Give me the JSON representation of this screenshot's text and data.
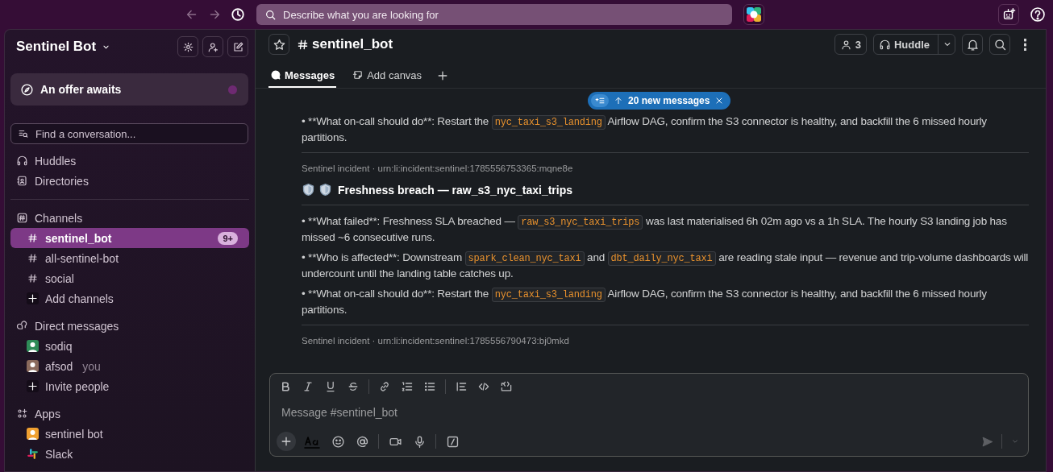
{
  "topbar": {
    "search_placeholder": "Describe what you are looking for"
  },
  "sidebar": {
    "workspace": "Sentinel Bot",
    "offer": {
      "label": "An offer awaits",
      "unread": true
    },
    "find_placeholder": "Find a conversation...",
    "nav": [
      {
        "kind": "huddles",
        "label": "Huddles"
      },
      {
        "kind": "directories",
        "label": "Directories"
      }
    ],
    "sections": [
      {
        "kind": "channels",
        "title": "Channels",
        "items": [
          {
            "kind": "channel",
            "label": "sentinel_bot",
            "selected": true,
            "badge": "9+"
          },
          {
            "kind": "channel",
            "label": "all-sentinel-bot",
            "selected": false
          },
          {
            "kind": "channel",
            "label": "social",
            "selected": false
          },
          {
            "kind": "add",
            "label": "Add channels",
            "selected": false
          }
        ]
      },
      {
        "kind": "dms",
        "title": "Direct messages",
        "items": [
          {
            "kind": "person",
            "label": "sodiq",
            "selected": false,
            "color": "#2e8b57"
          },
          {
            "kind": "person",
            "label": "afsod",
            "note": "you",
            "selected": false,
            "color": "#8a6a5c"
          },
          {
            "kind": "add",
            "label": "Invite people",
            "selected": false
          }
        ]
      },
      {
        "kind": "apps",
        "title": "Apps",
        "items": [
          {
            "kind": "app",
            "label": "sentinel bot",
            "selected": false,
            "color": "#f0a030"
          },
          {
            "kind": "slack",
            "label": "Slack",
            "selected": false
          }
        ]
      }
    ]
  },
  "channel": {
    "name": "sentinel_bot",
    "member_count": "3",
    "huddle": "Huddle",
    "tabs": [
      {
        "kind": "messages",
        "label": "Messages",
        "selected": true
      },
      {
        "kind": "canvas",
        "label": "Add canvas",
        "selected": false
      }
    ],
    "new_messages": "20 new messages",
    "messages": [
      {
        "kind": "bullet",
        "segments": [
          {
            "kind": "text",
            "text": "• **What on-call should do**: Restart the "
          },
          {
            "kind": "code",
            "text": "nyc_taxi_s3_landing"
          },
          {
            "kind": "text",
            "text": " Airflow DAG, confirm the S3 connector is healthy, and backfill the 6 missed hourly partitions."
          }
        ]
      },
      {
        "kind": "meta",
        "text": "Sentinel incident · urn:li:incident:sentinel:1785556753365:mqne8e"
      },
      {
        "kind": "heading",
        "text": "Freshness breach — raw_s3_nyc_taxi_trips"
      },
      {
        "kind": "bullet",
        "segments": [
          {
            "kind": "text",
            "text": "• **What failed**: Freshness SLA breached — "
          },
          {
            "kind": "code",
            "text": "raw_s3_nyc_taxi_trips"
          },
          {
            "kind": "text",
            "text": " was last materialised 6h 02m ago vs a 1h SLA. The hourly S3 landing job has missed ~6 consecutive runs."
          }
        ]
      },
      {
        "kind": "bullet",
        "segments": [
          {
            "kind": "text",
            "text": "• **Who is affected**: Downstream "
          },
          {
            "kind": "code",
            "text": "spark_clean_nyc_taxi"
          },
          {
            "kind": "text",
            "text": " and "
          },
          {
            "kind": "code",
            "text": "dbt_daily_nyc_taxi"
          },
          {
            "kind": "text",
            "text": " are reading stale input — revenue and trip-volume dashboards will undercount until the landing table catches up."
          }
        ]
      },
      {
        "kind": "bullet",
        "segments": [
          {
            "kind": "text",
            "text": "• **What on-call should do**: Restart the "
          },
          {
            "kind": "code",
            "text": "nyc_taxi_s3_landing"
          },
          {
            "kind": "text",
            "text": " Airflow DAG, confirm the S3 connector is healthy, and backfill the 6 missed hourly partitions."
          }
        ]
      },
      {
        "kind": "meta",
        "text": "Sentinel incident · urn:li:incident:sentinel:1785556790473:bj0mkd"
      }
    ],
    "composer": {
      "placeholder": "Message #sentinel_bot"
    }
  }
}
